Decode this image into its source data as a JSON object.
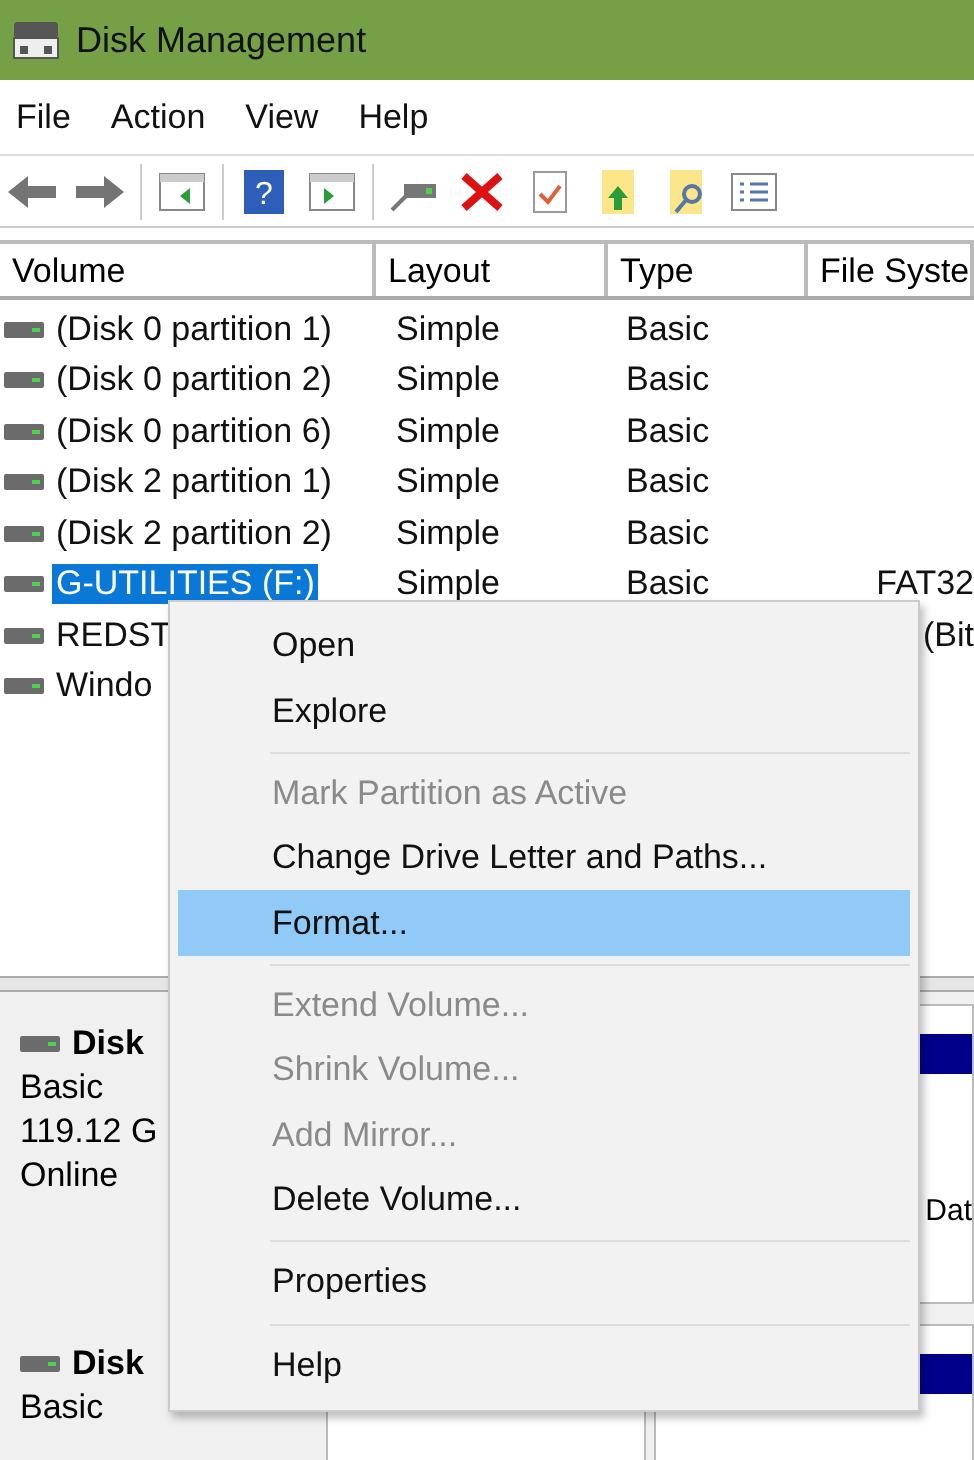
{
  "window": {
    "title": "Disk Management"
  },
  "menu_bar": [
    "File",
    "Action",
    "View",
    "Help"
  ],
  "toolbar": [
    {
      "kind": "back",
      "disabled": true
    },
    {
      "kind": "forward",
      "disabled": true
    },
    {
      "kind": "sep"
    },
    {
      "kind": "pane-left"
    },
    {
      "kind": "sep"
    },
    {
      "kind": "help",
      "label": "?"
    },
    {
      "kind": "pane-right"
    },
    {
      "kind": "sep"
    },
    {
      "kind": "connect"
    },
    {
      "kind": "delete"
    },
    {
      "kind": "check"
    },
    {
      "kind": "folder-up"
    },
    {
      "kind": "folder-search"
    },
    {
      "kind": "list"
    }
  ],
  "table": {
    "columns": [
      "Volume",
      "Layout",
      "Type",
      "File Syste"
    ],
    "rows": [
      {
        "cells": [
          "(Disk 0 partition 1)",
          "Simple",
          "Basic",
          ""
        ],
        "selected": false
      },
      {
        "cells": [
          "(Disk 0 partition 2)",
          "Simple",
          "Basic",
          ""
        ],
        "selected": false
      },
      {
        "cells": [
          "(Disk 0 partition 6)",
          "Simple",
          "Basic",
          ""
        ],
        "selected": false
      },
      {
        "cells": [
          "(Disk 2 partition 1)",
          "Simple",
          "Basic",
          ""
        ],
        "selected": false
      },
      {
        "cells": [
          "(Disk 2 partition 2)",
          "Simple",
          "Basic",
          ""
        ],
        "selected": false
      },
      {
        "cells": [
          "G-UTILITIES (F:)",
          "Simple",
          "Basic",
          "FAT32"
        ],
        "selected": true
      },
      {
        "cells": [
          "REDST",
          "",
          "",
          "(Bit"
        ],
        "selected": false
      },
      {
        "cells": [
          "Windo",
          "",
          "",
          ""
        ],
        "selected": false
      }
    ]
  },
  "disks": [
    {
      "name": "Disk",
      "lines": [
        "Basic",
        "119.12 G",
        "Online"
      ],
      "volume_text": "Dat"
    },
    {
      "name": "Disk",
      "lines": [
        "Basic"
      ]
    }
  ],
  "context_menu": [
    {
      "kind": "item",
      "label": "Open",
      "disabled": false,
      "selected": false
    },
    {
      "kind": "item",
      "label": "Explore",
      "disabled": false,
      "selected": false
    },
    {
      "kind": "sep"
    },
    {
      "kind": "item",
      "label": "Mark Partition as Active",
      "disabled": true,
      "selected": false
    },
    {
      "kind": "item",
      "label": "Change Drive Letter and Paths...",
      "disabled": false,
      "selected": false
    },
    {
      "kind": "item",
      "label": "Format...",
      "disabled": false,
      "selected": true
    },
    {
      "kind": "sep"
    },
    {
      "kind": "item",
      "label": "Extend Volume...",
      "disabled": true,
      "selected": false
    },
    {
      "kind": "item",
      "label": "Shrink Volume...",
      "disabled": true,
      "selected": false
    },
    {
      "kind": "item",
      "label": "Add Mirror...",
      "disabled": true,
      "selected": false
    },
    {
      "kind": "item",
      "label": "Delete Volume...",
      "disabled": false,
      "selected": false
    },
    {
      "kind": "sep"
    },
    {
      "kind": "item",
      "label": "Properties",
      "disabled": false,
      "selected": false
    },
    {
      "kind": "sep"
    },
    {
      "kind": "item",
      "label": "Help",
      "disabled": false,
      "selected": false
    }
  ]
}
